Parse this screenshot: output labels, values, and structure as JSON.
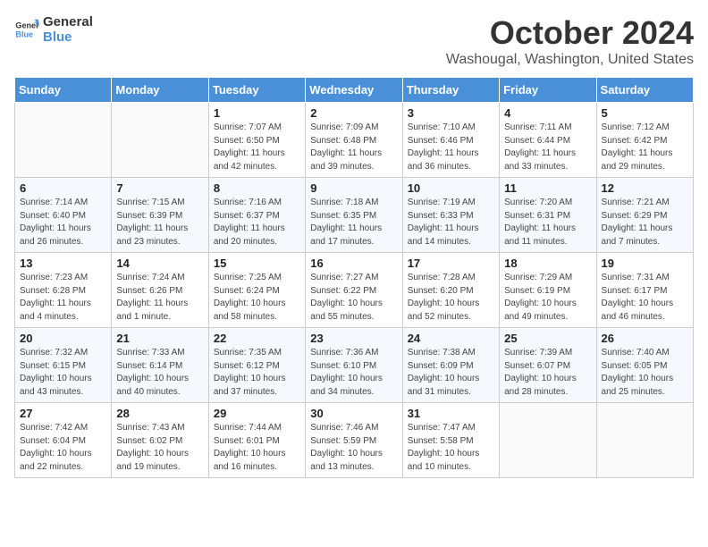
{
  "logo": {
    "line1": "General",
    "line2": "Blue"
  },
  "title": "October 2024",
  "subtitle": "Washougal, Washington, United States",
  "headers": [
    "Sunday",
    "Monday",
    "Tuesday",
    "Wednesday",
    "Thursday",
    "Friday",
    "Saturday"
  ],
  "weeks": [
    [
      {
        "day": "",
        "sunrise": "",
        "sunset": "",
        "daylight": ""
      },
      {
        "day": "",
        "sunrise": "",
        "sunset": "",
        "daylight": ""
      },
      {
        "day": "1",
        "sunrise": "Sunrise: 7:07 AM",
        "sunset": "Sunset: 6:50 PM",
        "daylight": "Daylight: 11 hours and 42 minutes."
      },
      {
        "day": "2",
        "sunrise": "Sunrise: 7:09 AM",
        "sunset": "Sunset: 6:48 PM",
        "daylight": "Daylight: 11 hours and 39 minutes."
      },
      {
        "day": "3",
        "sunrise": "Sunrise: 7:10 AM",
        "sunset": "Sunset: 6:46 PM",
        "daylight": "Daylight: 11 hours and 36 minutes."
      },
      {
        "day": "4",
        "sunrise": "Sunrise: 7:11 AM",
        "sunset": "Sunset: 6:44 PM",
        "daylight": "Daylight: 11 hours and 33 minutes."
      },
      {
        "day": "5",
        "sunrise": "Sunrise: 7:12 AM",
        "sunset": "Sunset: 6:42 PM",
        "daylight": "Daylight: 11 hours and 29 minutes."
      }
    ],
    [
      {
        "day": "6",
        "sunrise": "Sunrise: 7:14 AM",
        "sunset": "Sunset: 6:40 PM",
        "daylight": "Daylight: 11 hours and 26 minutes."
      },
      {
        "day": "7",
        "sunrise": "Sunrise: 7:15 AM",
        "sunset": "Sunset: 6:39 PM",
        "daylight": "Daylight: 11 hours and 23 minutes."
      },
      {
        "day": "8",
        "sunrise": "Sunrise: 7:16 AM",
        "sunset": "Sunset: 6:37 PM",
        "daylight": "Daylight: 11 hours and 20 minutes."
      },
      {
        "day": "9",
        "sunrise": "Sunrise: 7:18 AM",
        "sunset": "Sunset: 6:35 PM",
        "daylight": "Daylight: 11 hours and 17 minutes."
      },
      {
        "day": "10",
        "sunrise": "Sunrise: 7:19 AM",
        "sunset": "Sunset: 6:33 PM",
        "daylight": "Daylight: 11 hours and 14 minutes."
      },
      {
        "day": "11",
        "sunrise": "Sunrise: 7:20 AM",
        "sunset": "Sunset: 6:31 PM",
        "daylight": "Daylight: 11 hours and 11 minutes."
      },
      {
        "day": "12",
        "sunrise": "Sunrise: 7:21 AM",
        "sunset": "Sunset: 6:29 PM",
        "daylight": "Daylight: 11 hours and 7 minutes."
      }
    ],
    [
      {
        "day": "13",
        "sunrise": "Sunrise: 7:23 AM",
        "sunset": "Sunset: 6:28 PM",
        "daylight": "Daylight: 11 hours and 4 minutes."
      },
      {
        "day": "14",
        "sunrise": "Sunrise: 7:24 AM",
        "sunset": "Sunset: 6:26 PM",
        "daylight": "Daylight: 11 hours and 1 minute."
      },
      {
        "day": "15",
        "sunrise": "Sunrise: 7:25 AM",
        "sunset": "Sunset: 6:24 PM",
        "daylight": "Daylight: 10 hours and 58 minutes."
      },
      {
        "day": "16",
        "sunrise": "Sunrise: 7:27 AM",
        "sunset": "Sunset: 6:22 PM",
        "daylight": "Daylight: 10 hours and 55 minutes."
      },
      {
        "day": "17",
        "sunrise": "Sunrise: 7:28 AM",
        "sunset": "Sunset: 6:20 PM",
        "daylight": "Daylight: 10 hours and 52 minutes."
      },
      {
        "day": "18",
        "sunrise": "Sunrise: 7:29 AM",
        "sunset": "Sunset: 6:19 PM",
        "daylight": "Daylight: 10 hours and 49 minutes."
      },
      {
        "day": "19",
        "sunrise": "Sunrise: 7:31 AM",
        "sunset": "Sunset: 6:17 PM",
        "daylight": "Daylight: 10 hours and 46 minutes."
      }
    ],
    [
      {
        "day": "20",
        "sunrise": "Sunrise: 7:32 AM",
        "sunset": "Sunset: 6:15 PM",
        "daylight": "Daylight: 10 hours and 43 minutes."
      },
      {
        "day": "21",
        "sunrise": "Sunrise: 7:33 AM",
        "sunset": "Sunset: 6:14 PM",
        "daylight": "Daylight: 10 hours and 40 minutes."
      },
      {
        "day": "22",
        "sunrise": "Sunrise: 7:35 AM",
        "sunset": "Sunset: 6:12 PM",
        "daylight": "Daylight: 10 hours and 37 minutes."
      },
      {
        "day": "23",
        "sunrise": "Sunrise: 7:36 AM",
        "sunset": "Sunset: 6:10 PM",
        "daylight": "Daylight: 10 hours and 34 minutes."
      },
      {
        "day": "24",
        "sunrise": "Sunrise: 7:38 AM",
        "sunset": "Sunset: 6:09 PM",
        "daylight": "Daylight: 10 hours and 31 minutes."
      },
      {
        "day": "25",
        "sunrise": "Sunrise: 7:39 AM",
        "sunset": "Sunset: 6:07 PM",
        "daylight": "Daylight: 10 hours and 28 minutes."
      },
      {
        "day": "26",
        "sunrise": "Sunrise: 7:40 AM",
        "sunset": "Sunset: 6:05 PM",
        "daylight": "Daylight: 10 hours and 25 minutes."
      }
    ],
    [
      {
        "day": "27",
        "sunrise": "Sunrise: 7:42 AM",
        "sunset": "Sunset: 6:04 PM",
        "daylight": "Daylight: 10 hours and 22 minutes."
      },
      {
        "day": "28",
        "sunrise": "Sunrise: 7:43 AM",
        "sunset": "Sunset: 6:02 PM",
        "daylight": "Daylight: 10 hours and 19 minutes."
      },
      {
        "day": "29",
        "sunrise": "Sunrise: 7:44 AM",
        "sunset": "Sunset: 6:01 PM",
        "daylight": "Daylight: 10 hours and 16 minutes."
      },
      {
        "day": "30",
        "sunrise": "Sunrise: 7:46 AM",
        "sunset": "Sunset: 5:59 PM",
        "daylight": "Daylight: 10 hours and 13 minutes."
      },
      {
        "day": "31",
        "sunrise": "Sunrise: 7:47 AM",
        "sunset": "Sunset: 5:58 PM",
        "daylight": "Daylight: 10 hours and 10 minutes."
      },
      {
        "day": "",
        "sunrise": "",
        "sunset": "",
        "daylight": ""
      },
      {
        "day": "",
        "sunrise": "",
        "sunset": "",
        "daylight": ""
      }
    ]
  ]
}
